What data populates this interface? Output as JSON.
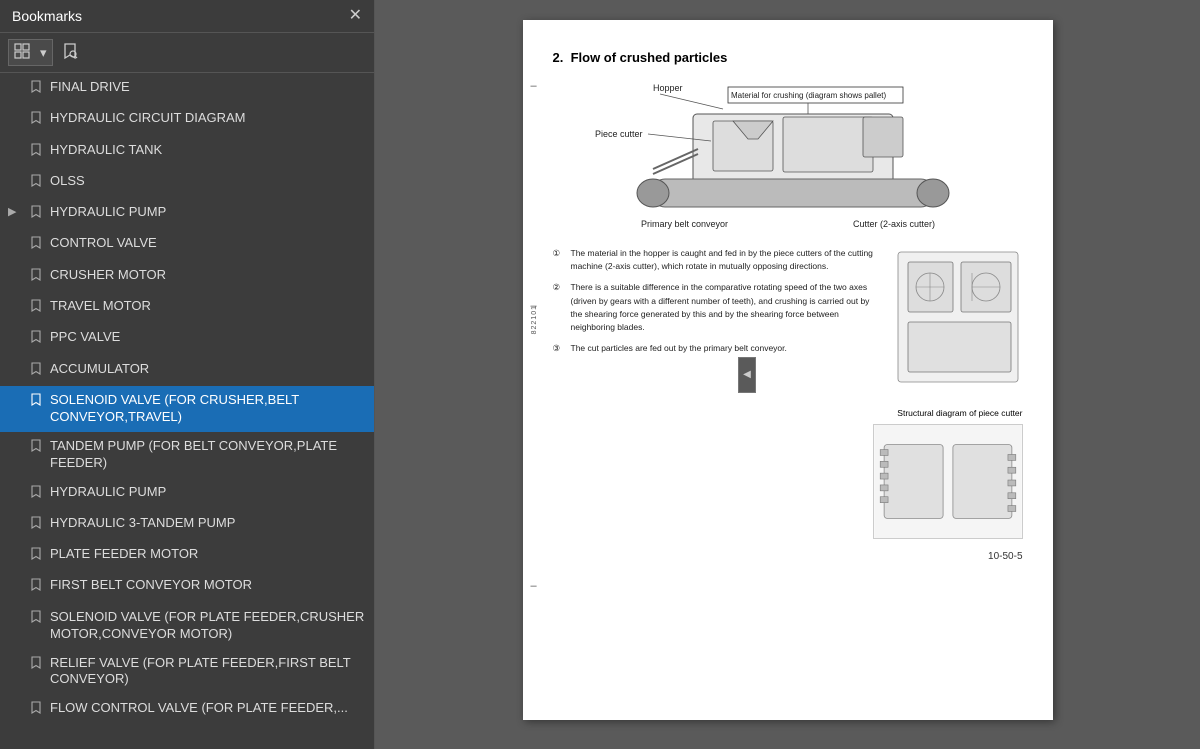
{
  "bookmarks": {
    "title": "Bookmarks",
    "close_label": "✕",
    "toolbar": {
      "grid_icon": "▦",
      "bookmark_icon": "🔖"
    },
    "items": [
      {
        "id": "final-drive",
        "label": "FINAL DRIVE",
        "indent": 0,
        "expanded": false,
        "active": false
      },
      {
        "id": "hydraulic-circuit-diagram",
        "label": "HYDRAULIC CIRCUIT DIAGRAM",
        "indent": 0,
        "expanded": false,
        "active": false
      },
      {
        "id": "hydraulic-tank",
        "label": "HYDRAULIC TANK",
        "indent": 0,
        "expanded": false,
        "active": false
      },
      {
        "id": "olss",
        "label": "OLSS",
        "indent": 0,
        "expanded": false,
        "active": false
      },
      {
        "id": "hydraulic-pump",
        "label": "HYDRAULIC PUMP",
        "indent": 0,
        "expanded": true,
        "active": false,
        "has_expand": true
      },
      {
        "id": "control-valve",
        "label": "CONTROL VALVE",
        "indent": 0,
        "expanded": false,
        "active": false
      },
      {
        "id": "crusher-motor",
        "label": "CRUSHER MOTOR",
        "indent": 0,
        "expanded": false,
        "active": false
      },
      {
        "id": "travel-motor",
        "label": "TRAVEL MOTOR",
        "indent": 0,
        "expanded": false,
        "active": false
      },
      {
        "id": "ppc-valve",
        "label": "PPC VALVE",
        "indent": 0,
        "expanded": false,
        "active": false
      },
      {
        "id": "accumulator",
        "label": "ACCUMULATOR",
        "indent": 0,
        "expanded": false,
        "active": false
      },
      {
        "id": "solenoid-valve-crusher",
        "label": "SOLENOID VALVE (FOR CRUSHER,BELT CONVEYOR,TRAVEL)",
        "indent": 0,
        "expanded": false,
        "active": true
      },
      {
        "id": "tandem-pump",
        "label": "TANDEM PUMP (FOR BELT CONVEYOR,PLATE FEEDER)",
        "indent": 0,
        "expanded": false,
        "active": false
      },
      {
        "id": "hydraulic-pump-2",
        "label": "HYDRAULIC PUMP",
        "indent": 0,
        "expanded": false,
        "active": false
      },
      {
        "id": "hydraulic-3-tandem",
        "label": "HYDRAULIC 3-TANDEM PUMP",
        "indent": 0,
        "expanded": false,
        "active": false
      },
      {
        "id": "plate-feeder-motor",
        "label": "PLATE FEEDER MOTOR",
        "indent": 0,
        "expanded": false,
        "active": false
      },
      {
        "id": "first-belt-conveyor-motor",
        "label": "FIRST BELT CONVEYOR MOTOR",
        "indent": 0,
        "expanded": false,
        "active": false
      },
      {
        "id": "solenoid-valve-plate",
        "label": "SOLENOID VALVE (FOR PLATE FEEDER,CRUSHER MOTOR,CONVEYOR MOTOR)",
        "indent": 0,
        "expanded": false,
        "active": false
      },
      {
        "id": "relief-valve",
        "label": "RELIEF VALVE (FOR PLATE FEEDER,FIRST BELT CONVEYOR)",
        "indent": 0,
        "expanded": false,
        "active": false
      },
      {
        "id": "flow-control-valve",
        "label": "FLOW CONTROL VALVE (FOR PLATE FEEDER,...",
        "indent": 0,
        "expanded": false,
        "active": false
      }
    ]
  },
  "document": {
    "section_number": "2.",
    "section_title": "Flow of crushed particles",
    "hopper_label": "Hopper",
    "material_label": "Material for crushing (diagram shows pallet)",
    "piece_cutter_label": "Piece cutter",
    "primary_belt_label": "Primary belt conveyor",
    "cutter_label": "Cutter (2-axis cutter)",
    "side_label": "822101",
    "text_items": [
      {
        "num": "①",
        "text": "The material in the hopper is caught and fed in by the piece cutters of the cutting machine (2-axis cutter), which rotate in mutually opposing directions."
      },
      {
        "num": "②",
        "text": "There is a suitable difference in the comparative rotating speed of the two axes (driven by gears with a different number of teeth), and crushing is carried out by the shearing force generated by this and by the shearing force between neighboring blades."
      },
      {
        "num": "③",
        "text": "The cut particles are fed out by the primary belt conveyor."
      }
    ],
    "structural_title": "Structural diagram of piece cutter",
    "page_number": "10-50-5",
    "line_markers": [
      "-",
      "-",
      "-"
    ]
  }
}
